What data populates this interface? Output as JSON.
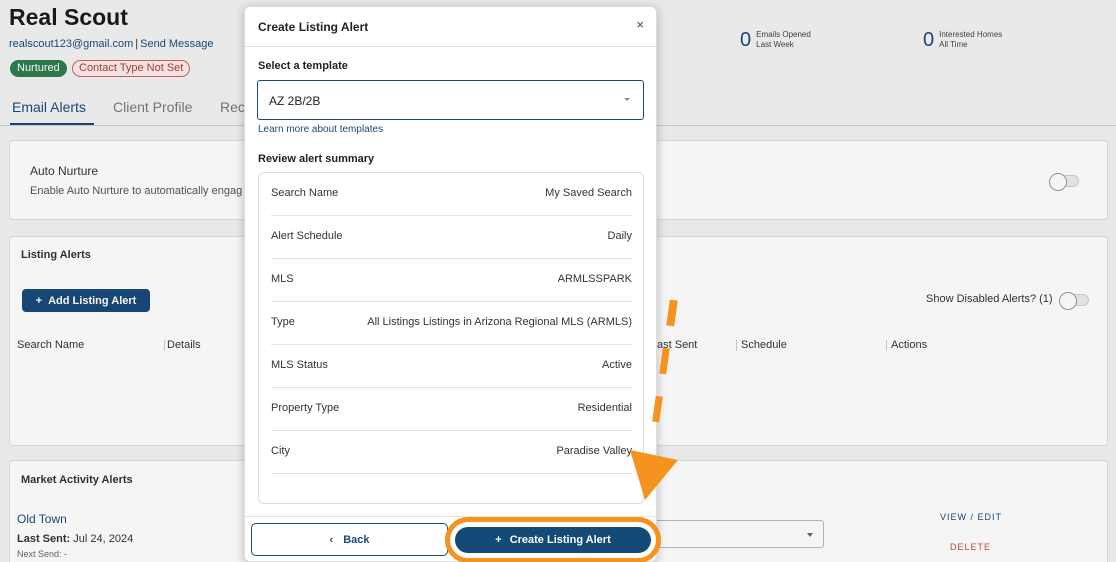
{
  "contact": {
    "name": "Real Scout",
    "email": "realscout123@gmail.com",
    "separator": "|",
    "send_message": "Send Message",
    "badge_nurtured": "Nurtured",
    "badge_contact_type": "Contact Type Not Set"
  },
  "stats": [
    {
      "value": "0",
      "line1": "Emails Opened",
      "line2": "Last Week"
    },
    {
      "value": "0",
      "line1": "Interested Homes",
      "line2": "All Time"
    }
  ],
  "tabs": [
    {
      "label": "Email Alerts"
    },
    {
      "label": "Client Profile"
    },
    {
      "label": "Rec"
    }
  ],
  "auto_nurture": {
    "title": "Auto Nurture",
    "description": "Enable Auto Nurture to automatically engag"
  },
  "listing_alerts": {
    "title": "Listing Alerts",
    "add_button": "Add Listing Alert",
    "show_disabled": "Show Disabled Alerts? (1)",
    "columns": [
      "Search Name",
      "Details",
      "ast Sent",
      "Schedule",
      "Actions"
    ]
  },
  "market_activity": {
    "title": "Market Activity Alerts",
    "item_name": "Old Town",
    "last_sent_label": "Last Sent:",
    "last_sent_value": "Jul 24, 2024",
    "next_send": "Next Send: -",
    "view_edit": "VIEW / EDIT",
    "delete": "DELETE"
  },
  "modal": {
    "title": "Create Listing Alert",
    "close": "×",
    "template_label": "Select a template",
    "template_value": "AZ 2B/2B",
    "learn_more": "Learn more about templates",
    "summary_label": "Review alert summary",
    "summary_rows": [
      {
        "key": "Search Name",
        "value": "My Saved Search"
      },
      {
        "key": "Alert Schedule",
        "value": "Daily"
      },
      {
        "key": "MLS",
        "value": "ARMLSSPARK"
      },
      {
        "key": "Type",
        "value": "All Listings Listings in Arizona Regional MLS (ARMLS)"
      },
      {
        "key": "MLS Status",
        "value": "Active"
      },
      {
        "key": "Property Type",
        "value": "Residential"
      },
      {
        "key": "City",
        "value": "Paradise Valley"
      }
    ],
    "back_button": "Back",
    "back_icon": "chevron-left-icon",
    "create_button": "Create Listing Alert",
    "create_icon": "plus-icon"
  },
  "colors": {
    "primary": "#1b4a7a",
    "highlight": "#f6931e",
    "danger": "#c84a4a"
  }
}
